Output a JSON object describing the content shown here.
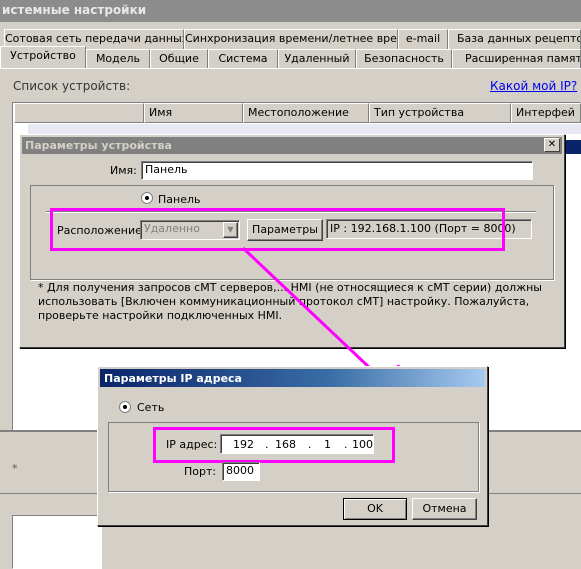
{
  "window": {
    "title": "истемные настройки"
  },
  "tabs_row1": [
    {
      "label": "Сотовая сеть передачи данных"
    },
    {
      "label": "Синхронизация времени/летнее время"
    },
    {
      "label": "e-mail"
    },
    {
      "label": "База данных рецептов"
    }
  ],
  "tabs_row2": [
    {
      "label": "Устройство"
    },
    {
      "label": "Модель"
    },
    {
      "label": "Общие"
    },
    {
      "label": "Система"
    },
    {
      "label": "Удаленный"
    },
    {
      "label": "Безопасность"
    },
    {
      "label": "Расширенная память"
    }
  ],
  "device_list": {
    "label": "Список устройств:",
    "my_ip_link": "Какой мой IP?",
    "columns": [
      "Имя",
      "Местоположение",
      "Тип устройства",
      "Интерфей"
    ]
  },
  "device_dialog": {
    "title": "Параметры устройства",
    "name_label": "Имя:",
    "name_value": "Панель",
    "radio_label": "Панель",
    "location_label": "Расположение:",
    "location_value": "Удаленно",
    "params_button": "Параметры",
    "ip_info": "IP : 192.168.1.100 (Порт = 8000)",
    "note_line1": "* Для получения запросов cMT серверов,... HMI (не относящиеся к cMT серии) должны",
    "note_line2": "использовать [Включен коммуникационный протокол cMT] настройку. Пожалуйста,",
    "note_line3": "проверьте настройки подключенных HMI."
  },
  "ip_dialog": {
    "title": "Параметры IP адреса",
    "radio_label": "Сеть",
    "ip_label": "IP адрес:",
    "ip_octets": [
      "192",
      "168",
      "1",
      "100"
    ],
    "port_label": "Порт:",
    "port_value": "8000",
    "ok_button": "OK",
    "cancel_button": "Отмена"
  },
  "colors": {
    "highlight": "#ff00ff",
    "active_title": "#0a246a",
    "link": "#0000ee"
  }
}
